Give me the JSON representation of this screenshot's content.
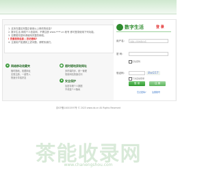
{
  "notice": {
    "lines": [
      "1. 这本在建议完整正使用以上修改的信息?",
      "2. 数字生活 网络个人信息网，不需注册 www.****.cn 帐号 即可登录使用下列功能。",
      "3. 如需更改密码请使用完整的网络。",
      "4. 注册用户如遇到上述问题，请联系我们。",
      "5. 本系统仅供学习交流使用。"
    ],
    "important": "! 完善您的信息 | 忘记密码?"
  },
  "features": [
    {
      "title": "网络移动收藏夹",
      "lines": [
        "随时随地，收藏网址",
        "无需注册，一键导入",
        "快速分享给好友"
      ]
    },
    {
      "title": "随时随地获取网址",
      "lines": [
        "多终端同步，统一管理",
        "常用网站快速访问",
        "支持分类整理"
      ]
    },
    {
      "title": "安全保护",
      "lines": [
        "加密存储个人数据",
        "不泄露个人隐私"
      ]
    }
  ],
  "login": {
    "logo_text": "数字生活",
    "logo_sub": "登 录",
    "username_label": "用户名:",
    "username_placeholder": "请输入您的用户名",
    "password_label": "密 码:",
    "password_placeholder": "",
    "remember_label": "记住密码",
    "captcha_label": "验证码:",
    "captcha_text": "8wG57",
    "auto_login_label": "下次自动登录",
    "login_button": "登 录",
    "register_button": "注 册",
    "forgot": "忘记密码?",
    "signup_link": "注册账号"
  },
  "footer": "京ICP备14001597号 © 2023 www.dx.cn All Rights Reserved",
  "watermark": {
    "text": "茶能收录网",
    "sub": "www.chanengshou.com"
  }
}
